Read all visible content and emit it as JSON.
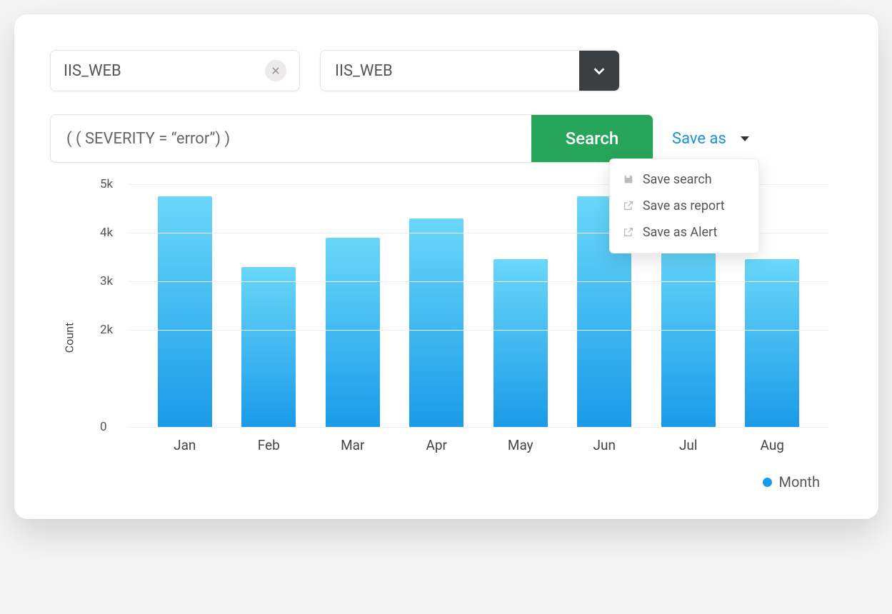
{
  "filter_chip": {
    "value": "IIS_WEB"
  },
  "source_select": {
    "value": "IIS_WEB"
  },
  "query": {
    "expression": "( ( SEVERITY = “error”) )",
    "search_label": "Search"
  },
  "save_as": {
    "label": "Save as",
    "menu": [
      {
        "label": "Save search"
      },
      {
        "label": "Save as report"
      },
      {
        "label": "Save as Alert"
      }
    ]
  },
  "chart_data": {
    "type": "bar",
    "categories": [
      "Jan",
      "Feb",
      "Mar",
      "Apr",
      "May",
      "Jun",
      "Jul",
      "Aug"
    ],
    "values": [
      4750,
      3300,
      3900,
      4300,
      3450,
      4750,
      3900,
      3450
    ],
    "ylabel": "Count",
    "xlabel": "",
    "ylim": [
      0,
      5000
    ],
    "y_ticks": [
      0,
      2000,
      3000,
      4000,
      5000
    ],
    "y_tick_labels": [
      "0",
      "2k",
      "3k",
      "4k",
      "5k"
    ],
    "legend": "Month"
  }
}
